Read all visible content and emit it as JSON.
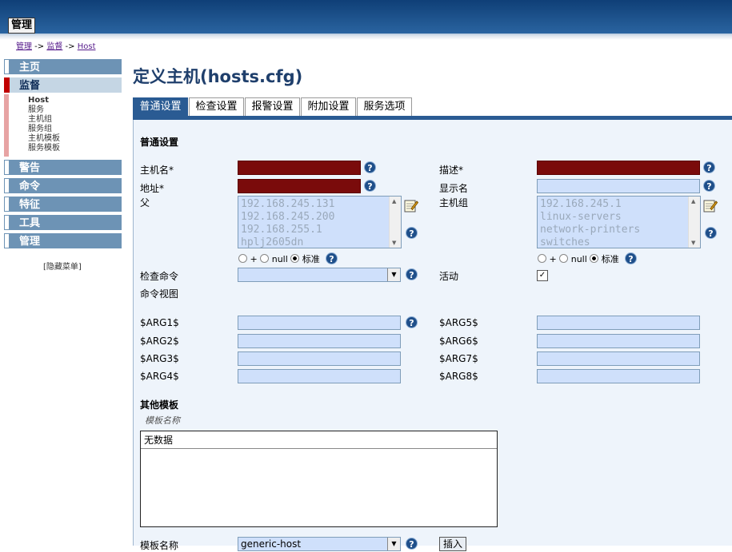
{
  "header": {
    "admin_button": "管理"
  },
  "breadcrumb": {
    "part1": "管理",
    "sep1": " -> ",
    "part2": "监督",
    "sep2": " -> ",
    "part3": "Host"
  },
  "sidebar": {
    "items": [
      {
        "label": "主页"
      },
      {
        "label": "监督"
      },
      {
        "label": "警告"
      },
      {
        "label": "命令"
      },
      {
        "label": "特征"
      },
      {
        "label": "工具"
      },
      {
        "label": "管理"
      }
    ],
    "submenu": [
      "Host",
      "服务",
      "主机组",
      "服务组",
      "主机模板",
      "服务模板"
    ],
    "hide_menu": "[隐藏菜单]"
  },
  "page": {
    "title": "定义主机(hosts.cfg)"
  },
  "tabs": [
    "普通设置",
    "检查设置",
    "报警设置",
    "附加设置",
    "服务选项"
  ],
  "form": {
    "section_general": "普通设置",
    "host_name_label": "主机名*",
    "description_label": "描述*",
    "address_label": "地址*",
    "display_name_label": "显示名",
    "parent_label": "父",
    "hostgroup_label": "主机组",
    "parents": [
      "192.168.245.131",
      "192.168.245.200",
      "192.168.255.1",
      "hplj2605dn"
    ],
    "hostgroups": [
      "192.168.245.1",
      "linux-servers",
      "network-printers",
      "switches"
    ],
    "radio_plus": "+",
    "radio_null": "null",
    "radio_std": "标准",
    "check_command_label": "检查命令",
    "active_label": "活动",
    "active_check": "✓",
    "command_view_label": "命令视图",
    "args": [
      "$ARG1$",
      "$ARG2$",
      "$ARG3$",
      "$ARG4$",
      "$ARG5$",
      "$ARG6$",
      "$ARG7$",
      "$ARG8$"
    ],
    "section_templates": "其他模板",
    "template_name_header": "模板名称",
    "no_data": "无数据",
    "template_name_label": "模板名称",
    "template_select_value": "generic-host",
    "insert_button": "插入"
  },
  "icons": {
    "help": "help-icon",
    "edit": "notepad-edit-icon"
  },
  "colors": {
    "required": "#7a0b0b",
    "field": "#cfe0fb",
    "accent": "#2a5b93"
  }
}
